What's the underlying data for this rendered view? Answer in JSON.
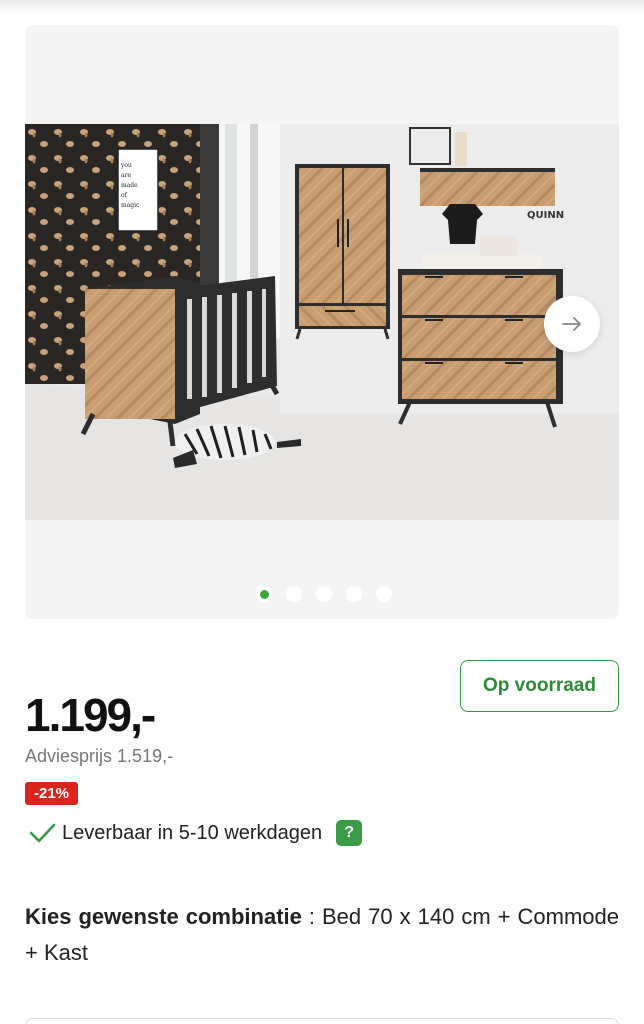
{
  "gallery": {
    "image_alt": "Babykamer Quinn",
    "dots_count": 5,
    "active_dot": 1,
    "photo_texts": {
      "poster": [
        "you",
        "are",
        "made",
        "of",
        "magic"
      ],
      "wall_brand": "QUINN"
    },
    "next_icon": "arrow-right-icon"
  },
  "product": {
    "price": "1.199,-",
    "advice_price": "Adviesprijs 1.519,-",
    "discount": "-21%",
    "stock_label": "Op voorraad",
    "delivery_text": "Leverbaar in 5-10 werkdagen",
    "help_label": "?"
  },
  "combination": {
    "label": "Kies gewenste combinatie",
    "separator": " : ",
    "value": "Bed 70 x 140 cm + Commode + Kast"
  },
  "colors": {
    "green": "#3a9a45",
    "red": "#d8251d"
  }
}
